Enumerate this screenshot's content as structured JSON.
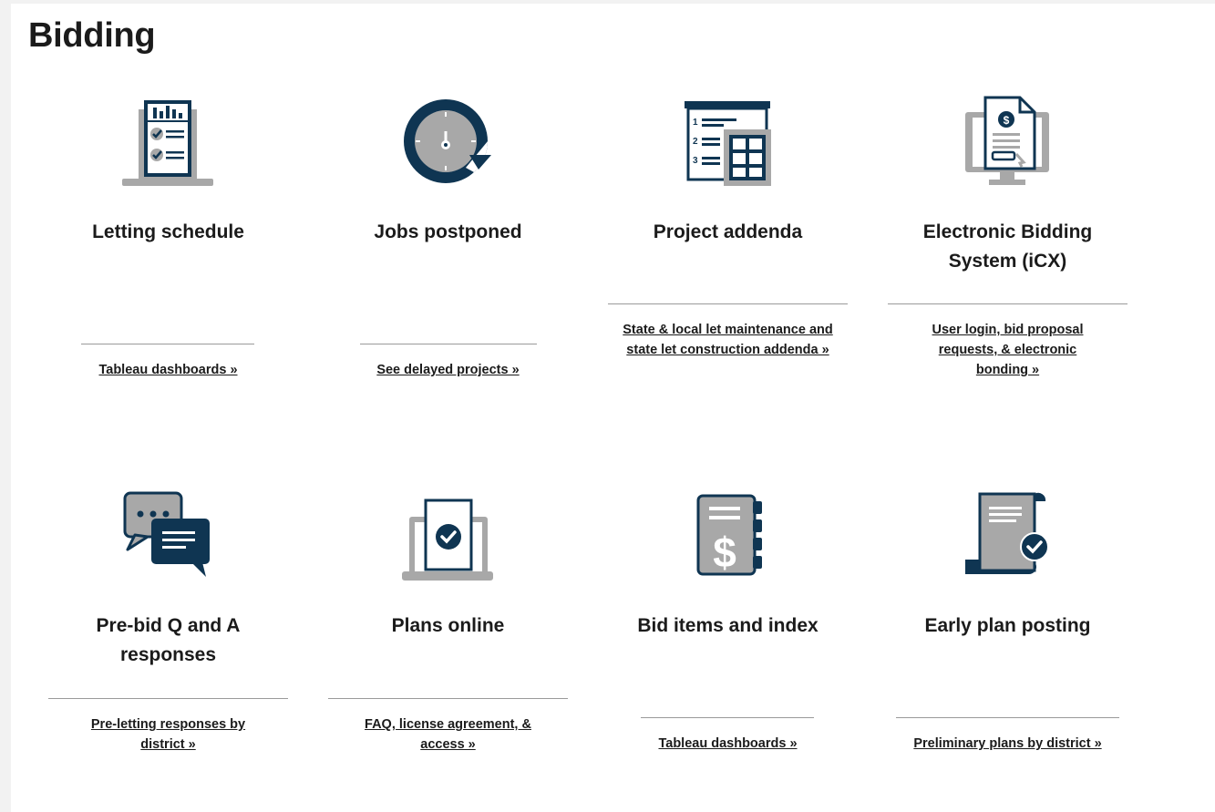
{
  "page": {
    "title": "Bidding"
  },
  "cards": [
    {
      "title": "Letting schedule",
      "link": "Tableau dashboards »",
      "icon": "laptop-checklist-icon"
    },
    {
      "title": "Jobs postponed",
      "link": "See delayed projects »",
      "icon": "clock-postpone-icon"
    },
    {
      "title": "Project addenda",
      "link": "State & local let maintenance and state let construction addenda »",
      "icon": "numbered-list-grid-icon"
    },
    {
      "title": "Electronic Bidding System (iCX)",
      "link": "User login, bid proposal requests, & electronic bonding »",
      "icon": "monitor-bid-document-icon"
    },
    {
      "title": "Pre-bid Q and A responses",
      "link": "Pre-letting responses by district »",
      "icon": "chat-bubbles-icon"
    },
    {
      "title": "Plans online",
      "link": "FAQ, license agreement, & access »",
      "icon": "laptop-document-check-icon"
    },
    {
      "title": "Bid items and index",
      "link": "Tableau dashboards »",
      "icon": "dollar-notebook-icon"
    },
    {
      "title": "Early plan posting",
      "link": "Preliminary plans by district »",
      "icon": "scroll-check-icon"
    }
  ],
  "colors": {
    "navy": "#0f3552",
    "gray": "#a8a8a8",
    "text": "#1b1b1b"
  }
}
